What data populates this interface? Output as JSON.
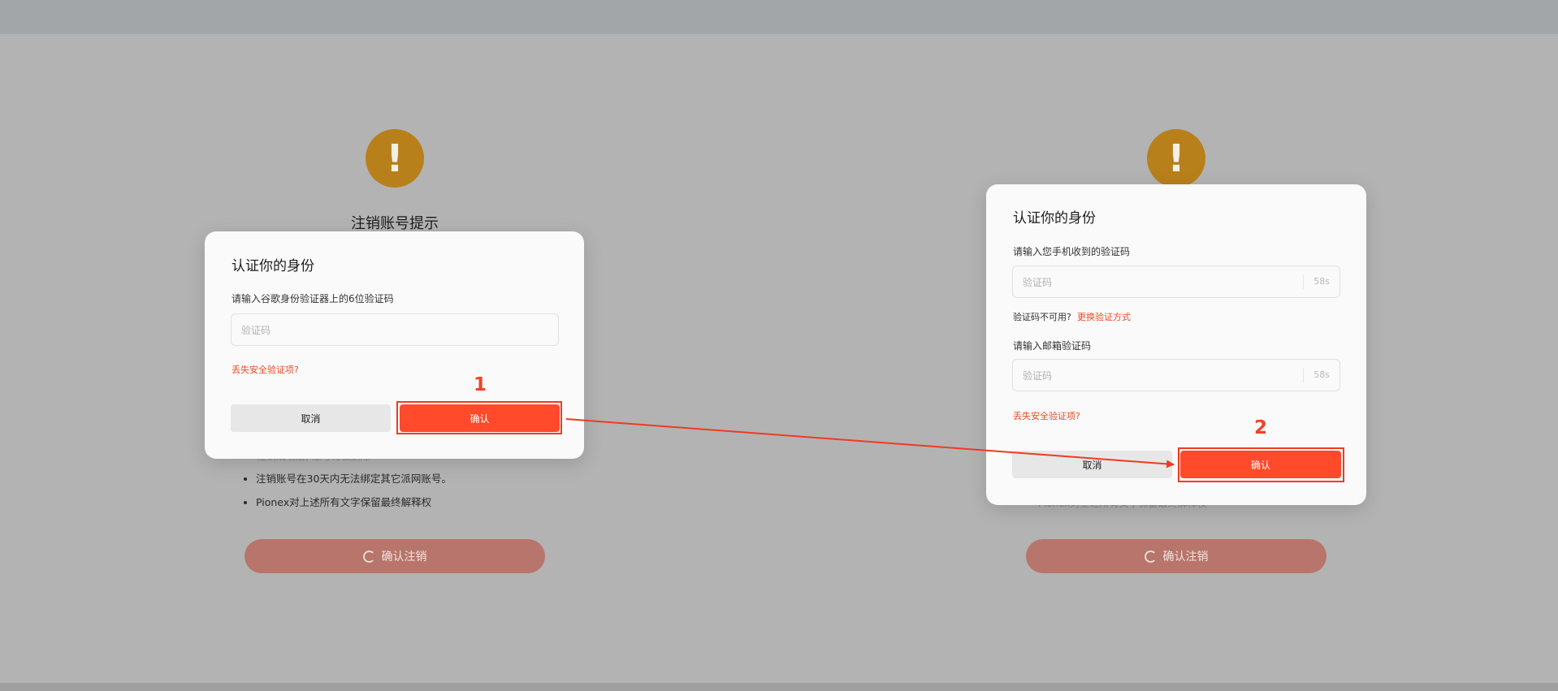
{
  "background_page": {
    "title": "注销账号提示",
    "bullets": [
      "注销账号在30天内无法绑定其它派网账号。",
      "Pionex对上述所有文字保留最终解释权"
    ],
    "submit_label": "确认注销",
    "partial_line_left": "注销成功后, 账号将被删除",
    "partial_line_right": "Pionex对上述所有文字保留最终解释权"
  },
  "modal_left": {
    "title": "认证你的身份",
    "field_label": "请输入谷歌身份验证器上的6位验证码",
    "code_placeholder": "验证码",
    "lost_link": "丢失安全验证项?",
    "cancel_label": "取消",
    "confirm_label": "确认",
    "step_number": "1"
  },
  "modal_right": {
    "title": "认证你的身份",
    "phone_label": "请输入您手机收到的验证码",
    "phone_placeholder": "验证码",
    "phone_countdown": "58s",
    "unavailable_text": "验证码不可用?",
    "switch_link": "更换验证方式",
    "email_label": "请输入邮箱验证码",
    "email_placeholder": "验证码",
    "email_countdown": "58s",
    "lost_link": "丢失安全验证项?",
    "cancel_label": "取消",
    "confirm_label": "确认",
    "step_number": "2"
  },
  "colors": {
    "accent": "#ff4a2b",
    "annotation": "#ef3b22",
    "warning_icon": "#b8801b",
    "overlay": "#b3b3b3"
  },
  "icons": {
    "warning": "exclamation-circle",
    "spinner": "loading-spinner",
    "arrow": "annotation-arrow"
  }
}
